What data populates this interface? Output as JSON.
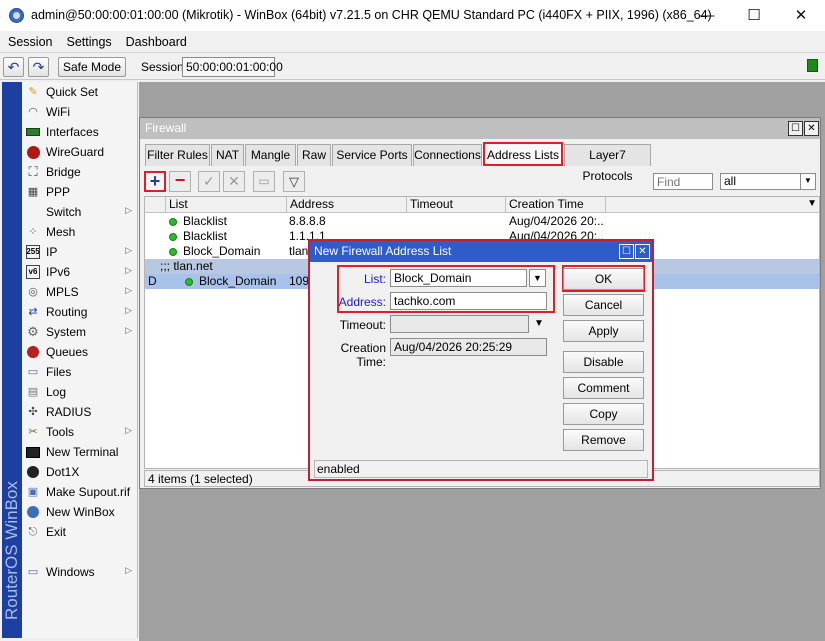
{
  "window": {
    "title": "admin@50:00:00:01:00:00 (Mikrotik) - WinBox (64bit) v7.21.5 on CHR QEMU Standard PC (i440FX + PIIX, 1996) (x86_64)",
    "minimize": "—",
    "maximize": "☐",
    "close": "✕"
  },
  "menu": {
    "items": [
      "Session",
      "Settings",
      "Dashboard"
    ]
  },
  "toolbar": {
    "undo": "↶",
    "redo": "↷",
    "safe_mode": "Safe Mode",
    "session_label": "Session:",
    "session_value": "50:00:00:01:00:00",
    "status_color": "#1a8a1a"
  },
  "brand": "RouterOS WinBox",
  "sidebar": {
    "items": [
      {
        "label": "Quick Set",
        "icon": "quick-set-icon"
      },
      {
        "label": "WiFi",
        "icon": "wifi-icon"
      },
      {
        "label": "Interfaces",
        "icon": "interfaces-icon"
      },
      {
        "label": "WireGuard",
        "icon": "wireguard-icon"
      },
      {
        "label": "Bridge",
        "icon": "bridge-icon"
      },
      {
        "label": "PPP",
        "icon": "ppp-icon"
      },
      {
        "label": "Switch",
        "icon": "switch-icon",
        "arrow": true
      },
      {
        "label": "Mesh",
        "icon": "mesh-icon"
      },
      {
        "label": "IP",
        "icon": "ip-icon",
        "arrow": true
      },
      {
        "label": "IPv6",
        "icon": "ipv6-icon",
        "arrow": true
      },
      {
        "label": "MPLS",
        "icon": "mpls-icon",
        "arrow": true
      },
      {
        "label": "Routing",
        "icon": "routing-icon",
        "arrow": true
      },
      {
        "label": "System",
        "icon": "system-icon",
        "arrow": true
      },
      {
        "label": "Queues",
        "icon": "queues-icon"
      },
      {
        "label": "Files",
        "icon": "files-icon"
      },
      {
        "label": "Log",
        "icon": "log-icon"
      },
      {
        "label": "RADIUS",
        "icon": "radius-icon"
      },
      {
        "label": "Tools",
        "icon": "tools-icon",
        "arrow": true
      },
      {
        "label": "New Terminal",
        "icon": "terminal-icon"
      },
      {
        "label": "Dot1X",
        "icon": "dot1x-icon"
      },
      {
        "label": "Make Supout.rif",
        "icon": "supout-icon"
      },
      {
        "label": "New WinBox",
        "icon": "new-winbox-icon"
      },
      {
        "label": "Exit",
        "icon": "exit-icon"
      },
      {
        "label": "Windows",
        "icon": "windows-icon",
        "arrow": true
      }
    ]
  },
  "firewall": {
    "title": "Firewall",
    "tabs": [
      "Filter Rules",
      "NAT",
      "Mangle",
      "Raw",
      "Service Ports",
      "Connections",
      "Address Lists",
      "Layer7 Protocols"
    ],
    "active_tab": "Address Lists",
    "find_placeholder": "Find",
    "filter_value": "all",
    "columns": [
      "List",
      "Address",
      "Timeout",
      "Creation Time"
    ],
    "rows": [
      {
        "flag": "",
        "list": "Blacklist",
        "address": "8.8.8.8",
        "timeout": "",
        "created": "Aug/04/2026 20:..."
      },
      {
        "flag": "",
        "list": "Blacklist",
        "address": "1.1.1.1",
        "timeout": "",
        "created": "Aug/04/2026 20:..."
      },
      {
        "flag": "",
        "list": "Block_Domain",
        "address": "tlan.net",
        "timeout": "",
        "created": ""
      },
      {
        "flag": "",
        "list": ";;; tlan.net",
        "address": "",
        "timeout": "",
        "created": "",
        "group": true
      },
      {
        "flag": "D",
        "list": "Block_Domain",
        "address": "109.",
        "timeout": "",
        "created": "",
        "selected": true
      }
    ],
    "status": "4 items (1 selected)"
  },
  "dialog": {
    "title": "New Firewall Address List",
    "list_label": "List:",
    "list_value": "Block_Domain",
    "address_label": "Address:",
    "address_value": "tachko.com",
    "timeout_label": "Timeout:",
    "timeout_value": "",
    "creation_label": "Creation Time:",
    "creation_value": "Aug/04/2026 20:25:29",
    "buttons": {
      "ok": "OK",
      "cancel": "Cancel",
      "apply": "Apply",
      "disable": "Disable",
      "comment": "Comment",
      "copy": "Copy",
      "remove": "Remove"
    },
    "status": "enabled"
  }
}
